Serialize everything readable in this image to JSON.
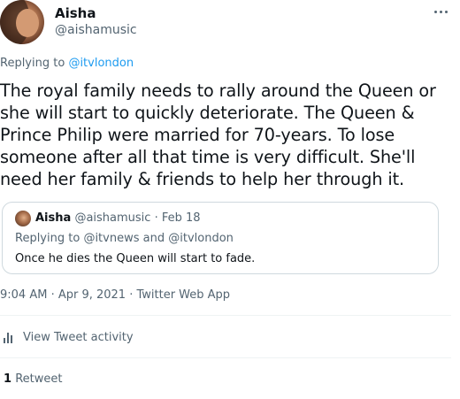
{
  "author": {
    "name": "Aisha",
    "handle": "@aishamusic"
  },
  "replying": {
    "prefix": "Replying to",
    "mention": "@itvlondon"
  },
  "tweet_text": "The royal family needs to rally around the Queen or she will start to quickly deteriorate. The Queen & Prince Philip were married for 70-years. To lose someone after all that time is very difficult. She'll need her family & friends to help her through it.",
  "quoted": {
    "name": "Aisha",
    "handle": "@aishamusic",
    "sep": "·",
    "date": "Feb 18",
    "replying_prefix": "Replying to",
    "mention1": "@itvnews",
    "and": "and",
    "mention2": "@itvlondon",
    "text": "Once he dies the Queen will start to fade."
  },
  "timestamp": "9:04 AM · Apr 9, 2021 · Twitter Web App",
  "activity_label": "View Tweet activity",
  "retweets": {
    "count": "1",
    "label": "Retweet"
  },
  "colors": {
    "link": "#1d9bf0",
    "secondary": "#536471",
    "border": "#cfd9de"
  },
  "icons": [
    "more-icon",
    "tweet-activity-icon"
  ]
}
